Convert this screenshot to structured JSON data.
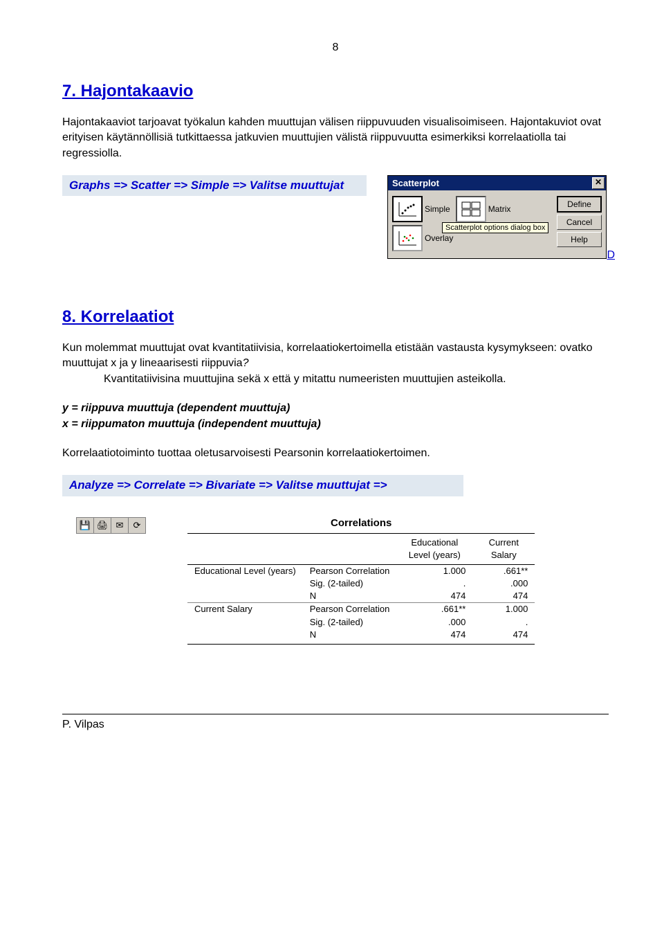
{
  "page_number": "8",
  "section7": {
    "title": "7. Hajontakaavio",
    "paragraph": "Hajontakaaviot tarjoavat työkalun kahden muuttujan välisen riippuvuuden visualisoimiseen. Hajontakuviot ovat erityisen käytännöllisiä tutkittaessa jatkuvien muuttujien välistä riippuvuutta esimerkiksi korrelaatiolla tai regressiolla.",
    "highlight": "Graphs => Scatter => Simple => Valitse muuttujat"
  },
  "dialog": {
    "title": "Scatterplot",
    "opts": {
      "simple": "Simple",
      "matrix": "Matrix",
      "overlay": "Overlay"
    },
    "buttons": {
      "define": "Define",
      "cancel": "Cancel",
      "help": "Help"
    },
    "tooltip": "Scatterplot options dialog box",
    "link_d": "D"
  },
  "section8": {
    "title": "8. Korrelaatiot",
    "p1": "Kun molemmat muuttujat ovat kvantitatiivisia, korrelaatiokertoimella etistään vastausta kysymykseen: ovatko muuttujat x ja y lineaarisesti riippuvia",
    "p1_cont": "Kvantitatiivisina muuttujina sekä  x että y mitattu numeeristen muuttujien asteikolla.",
    "italic_y": "y = riippuva muuttuja (dependent muuttuja)",
    "italic_x": "x = riippumaton muuttuja (independent muuttuja)",
    "p2": "Korrelaatiotoiminto tuottaa oletusarvoisesti  Pearsonin korrelaatiokertoimen.",
    "highlight": "Analyze => Correlate => Bivariate => Valitse muuttujat =>"
  },
  "corr": {
    "title": "Correlations",
    "col1": "Educational Level (years)",
    "col2": "Current Salary",
    "rows": {
      "r1_label": "Educational Level (years)",
      "r2_label": "Current Salary",
      "pearson": "Pearson Correlation",
      "sig": "Sig. (2-tailed)",
      "n": "N"
    },
    "vals": {
      "r1_pearson_c1": "1.000",
      "r1_pearson_c2": ".661**",
      "r1_sig_c1": ".",
      "r1_sig_c2": ".000",
      "r1_n_c1": "474",
      "r1_n_c2": "474",
      "r2_pearson_c1": ".661**",
      "r2_pearson_c2": "1.000",
      "r2_sig_c1": ".000",
      "r2_sig_c2": ".",
      "r2_n_c1": "474",
      "r2_n_c2": "474"
    }
  },
  "footer": "P. Vilpas"
}
